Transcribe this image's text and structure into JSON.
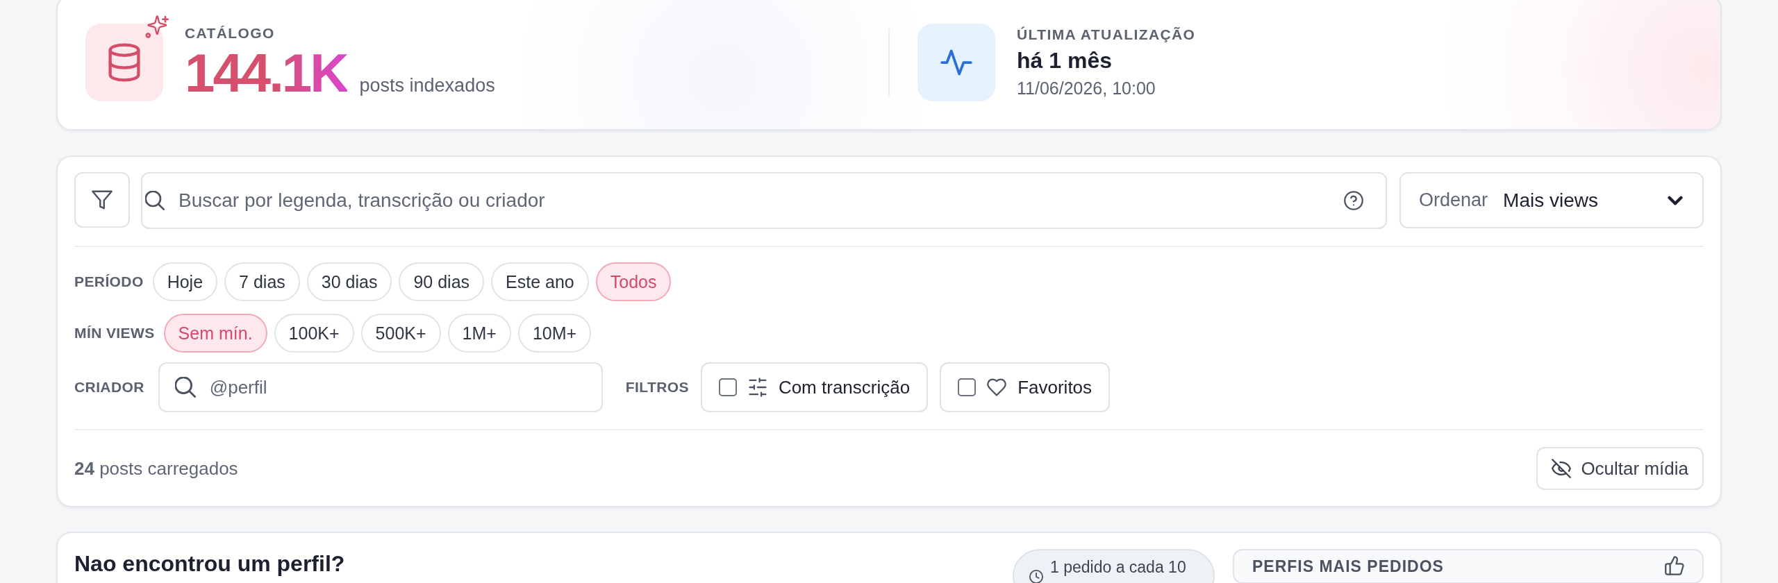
{
  "stats": {
    "catalog": {
      "label": "CATÁLOGO",
      "value": "144.1K",
      "caption": "posts indexados"
    },
    "update": {
      "label": "ÚLTIMA ATUALIZAÇÃO",
      "relative": "há 1 mês",
      "timestamp": "11/06/2026, 10:00"
    }
  },
  "search": {
    "placeholder": "Buscar por legenda, transcrição ou criador"
  },
  "sort": {
    "label": "Ordenar",
    "value": "Mais views"
  },
  "period": {
    "label": "PERÍODO",
    "options": [
      {
        "label": "Hoje",
        "selected": false
      },
      {
        "label": "7 dias",
        "selected": false
      },
      {
        "label": "30 dias",
        "selected": false
      },
      {
        "label": "90 dias",
        "selected": false
      },
      {
        "label": "Este ano",
        "selected": false
      },
      {
        "label": "Todos",
        "selected": true
      }
    ]
  },
  "min_views": {
    "label": "MÍN VIEWS",
    "options": [
      {
        "label": "Sem mín.",
        "selected": true
      },
      {
        "label": "100K+",
        "selected": false
      },
      {
        "label": "500K+",
        "selected": false
      },
      {
        "label": "1M+",
        "selected": false
      },
      {
        "label": "10M+",
        "selected": false
      }
    ]
  },
  "creator": {
    "label": "CRIADOR",
    "placeholder": "@perfil"
  },
  "filters": {
    "label": "FILTROS",
    "toggles": [
      {
        "kind": "transcript",
        "label": "Com transcrição",
        "checked": false
      },
      {
        "kind": "favorite",
        "label": "Favoritos",
        "checked": false
      }
    ]
  },
  "results": {
    "text": "**24** posts carregados"
  },
  "media_button": {
    "label": "Ocultar mídia"
  },
  "request": {
    "title": "Nao encontrou um perfil?",
    "rate_limit": "1 pedido a cada 10",
    "top_requests": {
      "title": "PERFIS MAIS PEDIDOS"
    }
  }
}
